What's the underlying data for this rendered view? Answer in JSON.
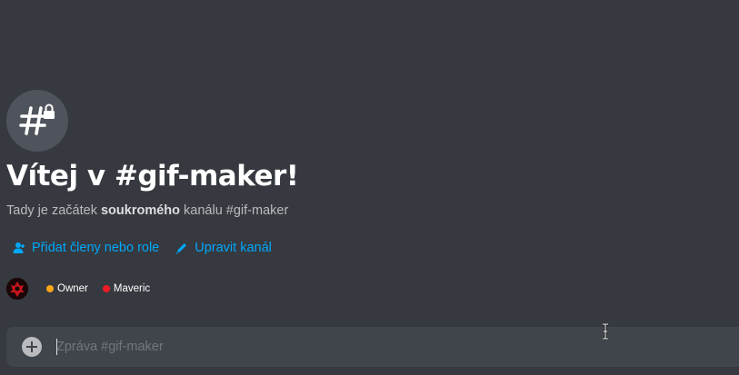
{
  "welcome": {
    "title": "Vítej v #gif-maker!",
    "subtitle_before": "Tady je začátek ",
    "subtitle_bold": "soukromého",
    "subtitle_after": " kanálu #gif-maker"
  },
  "actions": {
    "add_members_label": "Přidat členy nebo role",
    "edit_channel_label": "Upravit kanál"
  },
  "members": [
    {
      "name": "Owner",
      "color": "#faa61a"
    },
    {
      "name": "Maveric",
      "color": "#ed1c24"
    }
  ],
  "composer": {
    "placeholder": "Zpráva #gif-maker"
  },
  "icons": {
    "channel": "hashtag-lock-icon",
    "add_members": "person-add-icon",
    "edit_channel": "pencil-icon",
    "attach": "plus-circle-icon"
  },
  "colors": {
    "background": "#36393f",
    "link": "#00a8fc",
    "composer_bg": "#40444b"
  }
}
